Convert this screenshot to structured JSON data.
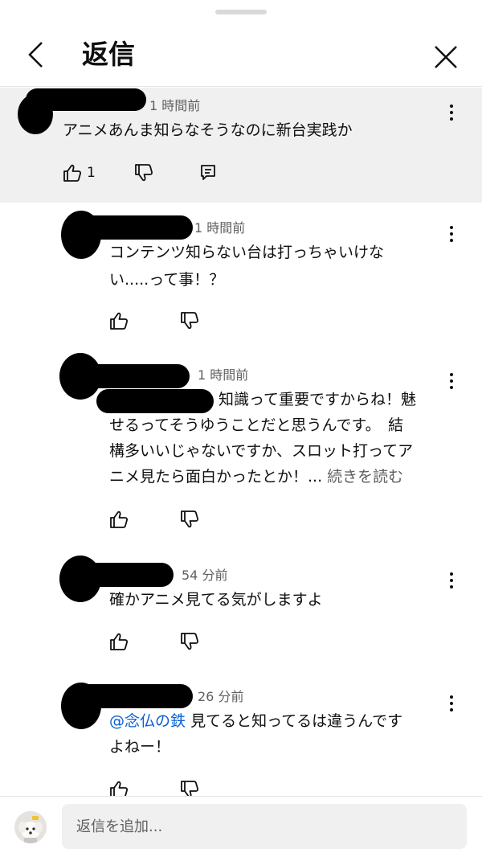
{
  "header": {
    "title": "返信"
  },
  "comments": [
    {
      "time": "1 時間前",
      "text": "アニメあんま知らなそうなのに新台実践か",
      "likes": "1"
    },
    {
      "time": "1 時間前",
      "text_line1": "コンテンツ知らない台は打っちゃいけな",
      "text_line2": "い.....って事！？"
    },
    {
      "time": "1 時間前",
      "text_line1": "知識って重要ですからね！魅",
      "text_line2": "せるってそうゆうことだと思うんです。　結",
      "text_line3": "構多いいじゃないですか、スロット打ってア",
      "text_line4": "ニメ見たら面白かったとか！...",
      "read_more": "続きを読む"
    },
    {
      "time": "54 分前",
      "text": "確かアニメ見てる気がしますよ"
    },
    {
      "time": "26 分前",
      "mention": "@念仏の鉄",
      "text_line1": "見てると知ってるは違うんです",
      "text_line2": "よねー！"
    }
  ],
  "reply_box": {
    "placeholder": "返信を追加..."
  },
  "icons": [
    "chevron-left-icon",
    "close-icon",
    "more-vert-icon",
    "thumb-up-icon",
    "thumb-down-icon",
    "reply-comment-icon"
  ]
}
